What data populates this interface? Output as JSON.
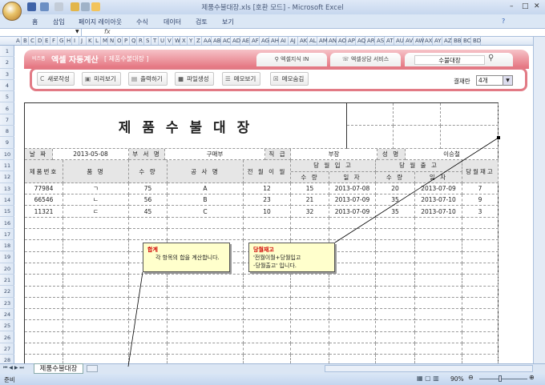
{
  "window": {
    "title": "제품수불대장.xls  [호환 모드] - Microsoft Excel"
  },
  "ribbon_tabs": [
    "홈",
    "삽입",
    "페이지 레이아웃",
    "수식",
    "데이터",
    "검토",
    "보기"
  ],
  "formula_bar": {
    "fx": "fx"
  },
  "columns": [
    "A",
    "B",
    "C",
    "D",
    "E",
    "F",
    "G",
    "H",
    "I",
    "J",
    "K",
    "L",
    "M",
    "N",
    "O",
    "P",
    "Q",
    "R",
    "S",
    "T",
    "U",
    "V",
    "W",
    "X",
    "Y",
    "Z",
    "AA",
    "AB",
    "AC",
    "AD",
    "AE",
    "AF",
    "AG",
    "AH",
    "AI",
    "AJ",
    "AK",
    "AL",
    "AM",
    "AN",
    "AO",
    "AP",
    "AQ",
    "AR",
    "AS",
    "AT",
    "AU",
    "AV",
    "AW",
    "AX",
    "AY",
    "AZ",
    "BB",
    "BC",
    "BD"
  ],
  "banner": {
    "brand_small": "비즈폼",
    "brand": "엑셀 자동계산",
    "subtitle": "[ 제품수불대장 ]",
    "link1": "엑셀지식 IN",
    "link2": "엑셀상담 서비스",
    "search_value": "수불대장",
    "buttons": [
      "새로작성",
      "미리보기",
      "출력하기",
      "파일생성",
      "메모보기",
      "메모숨김"
    ],
    "approval_label": "결재란",
    "approval_value": "4개"
  },
  "doc": {
    "title": "제 품 수 불 대 장",
    "info": {
      "date_label": "날 짜",
      "date": "2013-05-08",
      "dept_label": "부 서 명",
      "dept": "구매부",
      "rank_label": "직 급",
      "rank": "부장",
      "name_label": "성 명",
      "name": "이승철"
    },
    "headers": {
      "code": "제품번호",
      "item": "품    명",
      "qty": "수  량",
      "project": "공  사  명",
      "carry": "전 월 이 월",
      "in_group": "당 월 입 고",
      "out_group": "당 월 출 고",
      "in_qty": "수  량",
      "in_date": "일  자",
      "out_qty": "수  량",
      "out_date": "일  자",
      "stock": "당월재고"
    },
    "rows": [
      [
        "77984",
        "ㄱ",
        "75",
        "A",
        "12",
        "15",
        "2013-07-08",
        "20",
        "2013-07-09",
        "7"
      ],
      [
        "66546",
        "ㄴ",
        "56",
        "B",
        "23",
        "21",
        "2013-07-09",
        "35",
        "2013-07-10",
        "9"
      ],
      [
        "11321",
        "ㄷ",
        "45",
        "C",
        "10",
        "32",
        "2013-07-09",
        "35",
        "2013-07-10",
        "3"
      ]
    ]
  },
  "memos": [
    {
      "title": "합계",
      "text": "각 항목의 합을 계산합니다."
    },
    {
      "title": "당월재고",
      "text": "'전월이월+당월입고\n-당월출고' 입니다."
    }
  ],
  "sheet_tab": "제품수불대장",
  "status": {
    "ready": "준비",
    "zoom": "90%"
  }
}
